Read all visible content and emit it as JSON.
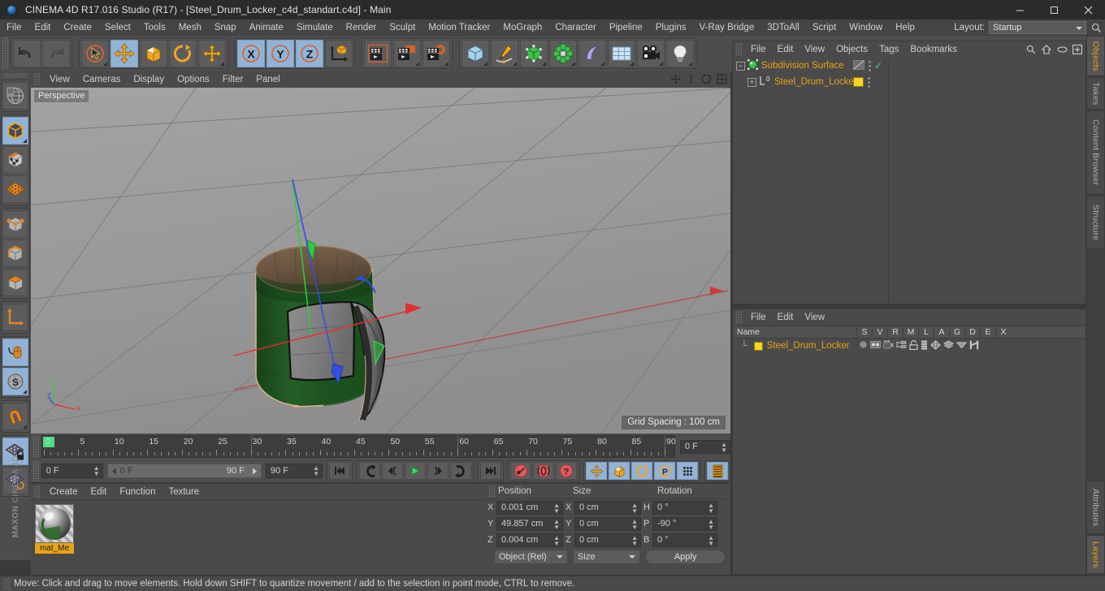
{
  "window": {
    "title": "CINEMA 4D R17.016 Studio (R17) - [Steel_Drum_Locker_c4d_standart.c4d] - Main",
    "minimize": "─",
    "maximize": "☐",
    "close": "✕"
  },
  "menubar": {
    "items": [
      "File",
      "Edit",
      "Create",
      "Select",
      "Tools",
      "Mesh",
      "Snap",
      "Animate",
      "Simulate",
      "Render",
      "Sculpt",
      "Motion Tracker",
      "MoGraph",
      "Character",
      "Pipeline",
      "Plugins",
      "V-Ray Bridge",
      "3DToAll",
      "Script",
      "Window",
      "Help"
    ],
    "layout_label": "Layout:",
    "layout_value": "Startup",
    "search_icon": "search-icon"
  },
  "toolbar": {
    "groups": [
      {
        "name": "history",
        "buttons": [
          {
            "name": "undo-icon",
            "label": "Undo",
            "selected": false,
            "corner": false
          },
          {
            "name": "redo-icon",
            "label": "Redo",
            "selected": false,
            "corner": false
          }
        ]
      },
      {
        "name": "tools",
        "buttons": [
          {
            "name": "select-icon",
            "label": "Live Selection",
            "selected": false,
            "corner": true
          },
          {
            "name": "move-icon",
            "label": "Move",
            "selected": true,
            "corner": false
          },
          {
            "name": "scale-icon",
            "label": "Scale",
            "selected": false,
            "corner": false
          },
          {
            "name": "rotate-icon",
            "label": "Rotate",
            "selected": false,
            "corner": false
          },
          {
            "name": "axis-move-icon",
            "label": "Move Axis",
            "selected": false,
            "corner": true
          }
        ]
      },
      {
        "name": "axes",
        "buttons": [
          {
            "name": "axis-x-icon",
            "label": "X",
            "selected": true,
            "corner": false
          },
          {
            "name": "axis-y-icon",
            "label": "Y",
            "selected": true,
            "corner": false
          },
          {
            "name": "axis-z-icon",
            "label": "Z",
            "selected": true,
            "corner": false
          },
          {
            "name": "world-coord-icon",
            "label": "World/Object",
            "selected": false,
            "corner": false
          }
        ]
      },
      {
        "name": "render",
        "buttons": [
          {
            "name": "render-view-icon",
            "label": "Render View",
            "selected": false,
            "corner": false
          },
          {
            "name": "render-picture-icon",
            "label": "Render to Picture Viewer",
            "selected": false,
            "corner": true
          },
          {
            "name": "render-settings-icon",
            "label": "Edit Render Settings",
            "selected": false,
            "corner": true
          }
        ]
      },
      {
        "name": "objects",
        "buttons": [
          {
            "name": "cube-primitive-icon",
            "label": "Add Cube Object",
            "selected": false,
            "corner": true
          },
          {
            "name": "spline-pen-icon",
            "label": "Add Spline",
            "selected": false,
            "corner": true
          },
          {
            "name": "generator-icon",
            "label": "Add Generator",
            "selected": false,
            "corner": true
          },
          {
            "name": "mograph-icon",
            "label": "Add MoGraph",
            "selected": false,
            "corner": true
          },
          {
            "name": "deformer-icon",
            "label": "Add Deformer",
            "selected": false,
            "corner": true
          },
          {
            "name": "scene-floor-icon",
            "label": "Add Scene Object",
            "selected": false,
            "corner": true
          },
          {
            "name": "camera-icon",
            "label": "Add Camera",
            "selected": false,
            "corner": true
          },
          {
            "name": "light-icon",
            "label": "Add Light",
            "selected": false,
            "corner": true
          }
        ]
      }
    ]
  },
  "left_toolbar": {
    "groups": [
      {
        "buttons": [
          {
            "name": "make-editable-icon",
            "selected": false,
            "corner": false
          }
        ]
      },
      {
        "buttons": [
          {
            "name": "model-mode-icon",
            "selected": true,
            "corner": true
          },
          {
            "name": "texture-mode-icon",
            "selected": false,
            "corner": false
          },
          {
            "name": "workplane-icon",
            "selected": false,
            "corner": false
          }
        ]
      },
      {
        "buttons": [
          {
            "name": "points-mode-icon",
            "selected": false,
            "corner": false
          },
          {
            "name": "edges-mode-icon",
            "selected": false,
            "corner": false
          },
          {
            "name": "polygons-mode-icon",
            "selected": false,
            "corner": false
          }
        ]
      },
      {
        "buttons": [
          {
            "name": "axis-mode-icon",
            "selected": false,
            "corner": false
          }
        ]
      },
      {
        "buttons": [
          {
            "name": "viewport-solo-icon",
            "selected": true,
            "corner": false
          },
          {
            "name": "soft-selection-icon",
            "selected": true,
            "corner": true
          }
        ]
      },
      {
        "buttons": [
          {
            "name": "snap-magnet-icon",
            "selected": false,
            "corner": true
          }
        ]
      },
      {
        "buttons": [
          {
            "name": "lock-workplane-icon",
            "selected": true,
            "corner": false
          },
          {
            "name": "planar-workplane-icon",
            "selected": false,
            "corner": false
          }
        ]
      }
    ],
    "brand_line1": "MAXON",
    "brand_line2": "CINEMA 4D"
  },
  "viewport": {
    "menu": [
      "View",
      "Cameras",
      "Display",
      "Options",
      "Filter",
      "Panel"
    ],
    "label": "Perspective",
    "grid_spacing": "Grid Spacing : 100 cm",
    "axis_x": "X",
    "axis_y": "Y",
    "axis_z": "Z",
    "corner_icons": [
      "pan-icon",
      "zoom-icon",
      "orbit-icon",
      "maximize-viewport-icon"
    ]
  },
  "timeline": {
    "ticks": [
      "0",
      "5",
      "10",
      "15",
      "20",
      "25",
      "30",
      "35",
      "40",
      "45",
      "50",
      "55",
      "60",
      "65",
      "70",
      "75",
      "80",
      "85",
      "90"
    ],
    "current_frame": "0 F"
  },
  "transport": {
    "current_frame": "0 F",
    "range_start": "0 F",
    "range_end": "90 F",
    "end_frame": "90 F",
    "buttons": [
      {
        "name": "goto-start-button",
        "selected": false
      },
      {
        "name": "prev-key-button",
        "selected": false
      },
      {
        "name": "step-back-button",
        "selected": false
      },
      {
        "name": "play-button",
        "selected": false
      },
      {
        "name": "step-forward-button",
        "selected": false
      },
      {
        "name": "next-key-button",
        "selected": false
      },
      {
        "name": "goto-end-button",
        "selected": false
      },
      {
        "name": "record-key-button",
        "selected": false
      },
      {
        "name": "autokey-button",
        "selected": false
      },
      {
        "name": "keyframe-selection-button",
        "selected": false
      },
      {
        "name": "key-position-button",
        "selected": true
      },
      {
        "name": "key-scale-button",
        "selected": true
      },
      {
        "name": "key-rotation-button",
        "selected": true
      },
      {
        "name": "key-param-button",
        "selected": true
      },
      {
        "name": "key-pla-button",
        "selected": false
      },
      {
        "name": "timeline-toggle-button",
        "selected": true
      }
    ]
  },
  "material_manager": {
    "menu": [
      "Create",
      "Edit",
      "Function",
      "Texture"
    ],
    "materials": [
      {
        "name": "mat_Me",
        "full_name": "mat_Metal"
      }
    ]
  },
  "coordinates": {
    "headers": [
      "Position",
      "Size",
      "Rotation"
    ],
    "rows": [
      {
        "pos_axis": "X",
        "pos_value": "0.001 cm",
        "size_axis": "X",
        "size_value": "0 cm",
        "rot_axis": "H",
        "rot_value": "0 °"
      },
      {
        "pos_axis": "Y",
        "pos_value": "49.857 cm",
        "size_axis": "Y",
        "size_value": "0 cm",
        "rot_axis": "P",
        "rot_value": "-90 °"
      },
      {
        "pos_axis": "Z",
        "pos_value": "0.004 cm",
        "size_axis": "Z",
        "size_value": "0 cm",
        "rot_axis": "B",
        "rot_value": "0 °"
      }
    ],
    "mode_dropdown": "Object (Rel)",
    "size_dropdown": "Size",
    "apply_button": "Apply"
  },
  "object_manager": {
    "menu": [
      "File",
      "Edit",
      "View",
      "Objects",
      "Tags",
      "Bookmarks"
    ],
    "right_icons": [
      "search-icon",
      "home-icon",
      "eye-icon",
      "add-icon"
    ],
    "rows": [
      {
        "name": "Subdivision Surface",
        "indent": 0,
        "tag_glyph": "subdiv-tag-icon",
        "check": "✓",
        "swatch": null
      },
      {
        "name": "Steel_Drum_Locker",
        "indent": 1,
        "tag_glyph": "level-zero-icon",
        "check": null,
        "swatch": "#f2d724"
      }
    ]
  },
  "layer_manager": {
    "menu": [
      "File",
      "Edit",
      "View"
    ],
    "columns": [
      "Name",
      "S",
      "V",
      "R",
      "M",
      "L",
      "A",
      "G",
      "D",
      "E",
      "X"
    ],
    "rows": [
      {
        "name": "Steel_Drum_Locker",
        "color": "#f2d724",
        "icons": [
          "solo-dot-icon",
          "visible-icon",
          "render-icon",
          "manager-icon",
          "lock-icon",
          "animation-icon",
          "generator-icon",
          "deformer-icon",
          "expression-icon",
          "xpresso-icon"
        ]
      }
    ]
  },
  "vertical_tabs": {
    "top": [
      {
        "label": "Objects",
        "active": true
      },
      {
        "label": "Takes",
        "active": false
      },
      {
        "label": "Content Browser",
        "active": false
      },
      {
        "label": "Structure",
        "active": false
      }
    ],
    "bottom": [
      {
        "label": "Attributes",
        "active": false
      },
      {
        "label": "Layers",
        "active": true
      }
    ]
  },
  "statusbar": {
    "text": "Move: Click and drag to move elements. Hold down SHIFT to quantize movement / add to the selection in point mode, CTRL to remove."
  },
  "colors": {
    "accent_orange": "#e8a317",
    "panel_bg": "#4a4a4a",
    "toolbar_bg": "#4d4d4d",
    "field_bg": "#3d3d3d",
    "selected_blue": "#93b3d6",
    "axis_x_red": "#e03030",
    "axis_y_green": "#2ecc40",
    "axis_z_blue": "#3050e0",
    "drum_green": "#1e5a22",
    "layer_yellow": "#f2d724"
  }
}
